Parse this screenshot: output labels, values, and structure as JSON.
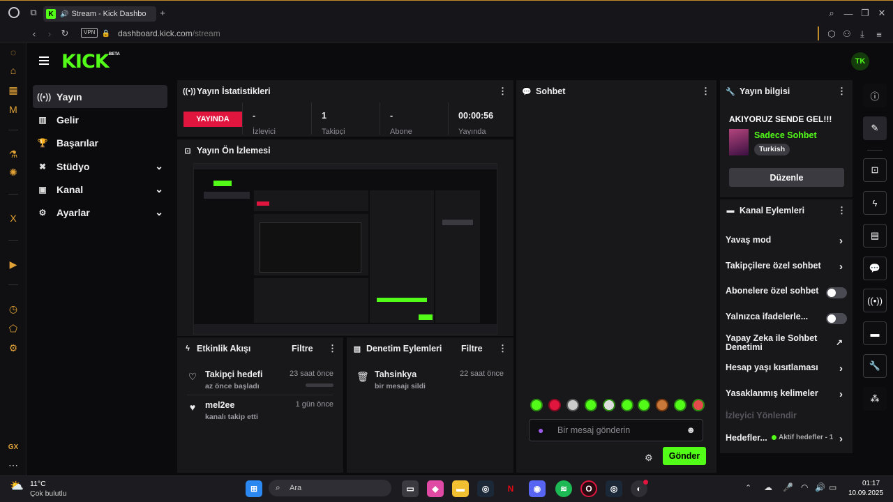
{
  "browser": {
    "tab_title": "Stream - Kick Dashbo",
    "url_domain": "dashboard.kick.com",
    "url_path": "/stream",
    "vpn_label": "VPN"
  },
  "logo": {
    "text": "KICK",
    "badge": "BETA"
  },
  "avatar": {
    "initials": "TK"
  },
  "nav": {
    "items": [
      {
        "label": "Yayın",
        "icon": "broadcast-icon"
      },
      {
        "label": "Gelir",
        "icon": "chart-icon"
      },
      {
        "label": "Başarılar",
        "icon": "trophy-icon"
      },
      {
        "label": "Stüdyo",
        "icon": "studio-icon"
      },
      {
        "label": "Kanal",
        "icon": "channel-icon"
      },
      {
        "label": "Ayarlar",
        "icon": "gear-icon"
      }
    ]
  },
  "stats": {
    "title": "Yayın İstatistikleri",
    "live_badge": "YAYINDA",
    "items": [
      {
        "value": "-",
        "label": "İzleyici"
      },
      {
        "value": "1",
        "label": "Takipçi"
      },
      {
        "value": "-",
        "label": "Abone"
      },
      {
        "value": "00:00:56",
        "label": "Yayında"
      }
    ]
  },
  "preview": {
    "title": "Yayın Ön İzlemesi"
  },
  "activity": {
    "title": "Etkinlik Akışı",
    "filter": "Filtre",
    "events": [
      {
        "title": "Takipçi hedefi",
        "sub": "az önce başladı",
        "time": "23 saat önce"
      },
      {
        "title": "mel2ee",
        "sub": "kanalı takip etti",
        "time": "1 gün önce"
      }
    ]
  },
  "moderation": {
    "title": "Denetim Eylemleri",
    "filter": "Filtre",
    "events": [
      {
        "title": "Tahsinkya",
        "sub": "bir mesajı sildi",
        "time": "22 saat önce"
      }
    ]
  },
  "chat": {
    "title": "Sohbet",
    "placeholder": "Bir mesaj gönderin",
    "send": "Gönder"
  },
  "info": {
    "title": "Yayın bilgisi",
    "stream_title": "AKIYORUZ SENDE GEL!!!",
    "category": "Sadece Sohbet",
    "language": "Turkish",
    "edit": "Düzenle"
  },
  "actions": {
    "title": "Kanal Eylemleri",
    "items": [
      {
        "label": "Yavaş mod",
        "kind": "arrow"
      },
      {
        "label": "Takipçilere özel sohbet",
        "kind": "arrow"
      },
      {
        "label": "Abonelere özel sohbet",
        "kind": "toggle"
      },
      {
        "label": "Yalnızca ifadelerle...",
        "kind": "toggle"
      },
      {
        "label": "Yapay Zeka ile Sohbet Denetimi",
        "kind": "external"
      },
      {
        "label": "Hesap yaşı kısıtlaması",
        "kind": "arrow"
      },
      {
        "label": "Yasaklanmış kelimeler",
        "kind": "arrow"
      }
    ],
    "disabled_label": "İzleyici Yönlendir",
    "goals_label": "Hedefler...",
    "goals_status": "Aktif hedefler - 1"
  },
  "taskbar": {
    "weather_temp": "11°C",
    "weather_desc": "Çok bulutlu",
    "search": "Ara",
    "time": "01:17",
    "date": "10.09.2025"
  },
  "colors": {
    "accent": "#53fc18",
    "live": "#e0163f",
    "chrome_accent": "#c08a2a"
  }
}
